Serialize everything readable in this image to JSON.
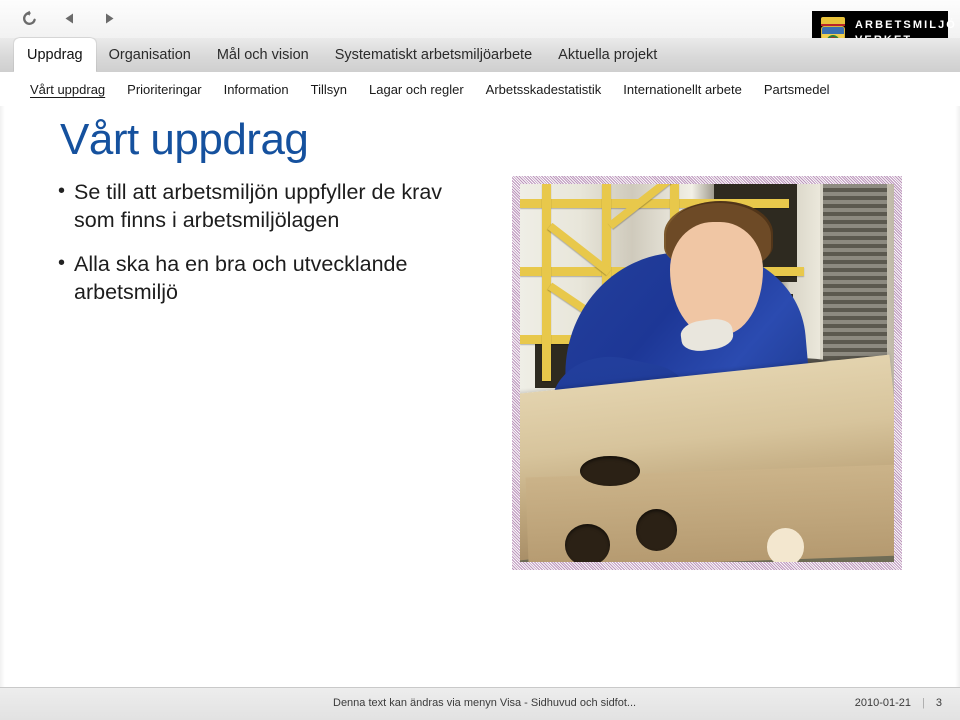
{
  "toolbar": {
    "buttons": [
      {
        "name": "refresh-icon",
        "label": "Uppdatera"
      },
      {
        "name": "back-icon",
        "label": "Föregående"
      },
      {
        "name": "forward-icon",
        "label": "Nästa"
      }
    ]
  },
  "logo": {
    "line1": "ARBETSMILJÖ",
    "line2": "VERKET",
    "background": "#000000",
    "text_color": "#ffffff"
  },
  "nav": {
    "tabs": [
      {
        "label": "Uppdrag",
        "active": true
      },
      {
        "label": "Organisation",
        "active": false
      },
      {
        "label": "Mål och vision",
        "active": false
      },
      {
        "label": "Systematiskt arbetsmiljöarbete",
        "active": false
      },
      {
        "label": "Aktuella projekt",
        "active": false
      }
    ]
  },
  "subnav": {
    "items": [
      {
        "label": "Vårt uppdrag",
        "active": true
      },
      {
        "label": "Prioriteringar",
        "active": false
      },
      {
        "label": "Information",
        "active": false
      },
      {
        "label": "Tillsyn",
        "active": false
      },
      {
        "label": "Lagar och regler",
        "active": false
      },
      {
        "label": "Arbetsskadestatistik",
        "active": false
      },
      {
        "label": "Internationellt arbete",
        "active": false
      },
      {
        "label": "Partsmedel",
        "active": false
      }
    ]
  },
  "slide": {
    "title": "Vårt uppdrag",
    "title_color": "#15519e",
    "bullet_marker": "•",
    "bullets": [
      "Se till att arbetsmiljön uppfyller de krav som finns i arbetsmiljölagen",
      "Alla ska ha en bra och utvecklande arbetsmiljö"
    ],
    "photo_alt": "Man i blå arbetsoverall som arbetar vid en träbänk i en verkstad"
  },
  "footer": {
    "text": "Denna text kan ändras via menyn Visa - Sidhuvud och sidfot...",
    "date": "2010-01-21",
    "separator": "|",
    "page_number": "3"
  }
}
